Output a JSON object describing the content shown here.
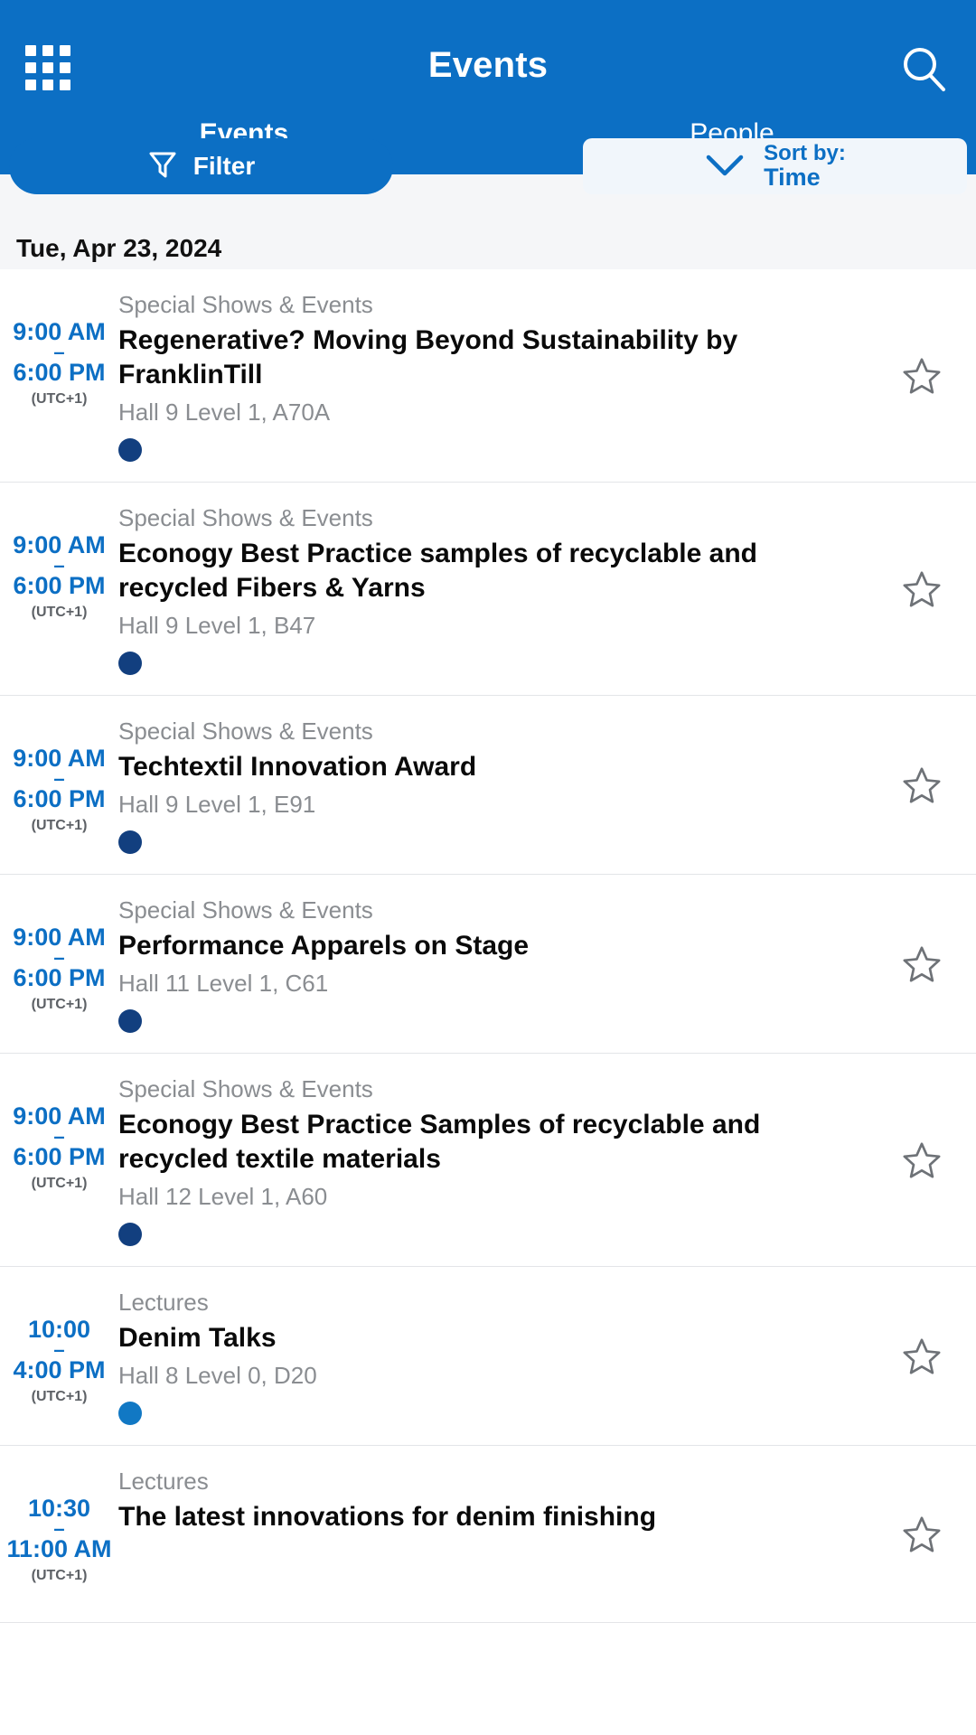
{
  "header": {
    "title": "Events",
    "menu_icon": "grid-icon",
    "search_icon": "search-icon"
  },
  "tabs": [
    {
      "label": "Events",
      "active": true
    },
    {
      "label": "People",
      "active": false
    }
  ],
  "toolbar": {
    "filter_label": "Filter",
    "filter_icon": "funnel-icon",
    "sort_line1": "Sort by:",
    "sort_line2": "Time",
    "sort_icon": "chevron-down-icon"
  },
  "date_header": "Tue, Apr 23, 2024",
  "colors": {
    "brand_blue": "#0C6FC4",
    "special_shows_dot": "#123F7F",
    "lectures_dot": "#1178C4",
    "tab_indicator": "#A8CCEB",
    "muted_text": "#8A8D91"
  },
  "events": [
    {
      "start": "9:00 AM",
      "dash": "–",
      "end": "6:00 PM",
      "tz": "(UTC+1)",
      "category": "Special Shows & Events",
      "title": "Regenerative? Moving Beyond Sustainability by FranklinTill",
      "location": "Hall 9 Level 1, A70A",
      "dot_color": "#123F7F",
      "starred": false
    },
    {
      "start": "9:00 AM",
      "dash": "–",
      "end": "6:00 PM",
      "tz": "(UTC+1)",
      "category": "Special Shows & Events",
      "title": "Econogy Best Practice samples of recyclable and recycled Fibers & Yarns",
      "location": "Hall 9 Level 1, B47",
      "dot_color": "#123F7F",
      "starred": false
    },
    {
      "start": "9:00 AM",
      "dash": "–",
      "end": "6:00 PM",
      "tz": "(UTC+1)",
      "category": "Special Shows & Events",
      "title": "Techtextil Innovation Award",
      "location": "Hall 9 Level 1, E91",
      "dot_color": "#123F7F",
      "starred": false
    },
    {
      "start": "9:00 AM",
      "dash": "–",
      "end": "6:00 PM",
      "tz": "(UTC+1)",
      "category": "Special Shows & Events",
      "title": "Performance Apparels on Stage",
      "location": "Hall 11 Level 1, C61",
      "dot_color": "#123F7F",
      "starred": false
    },
    {
      "start": "9:00 AM",
      "dash": "–",
      "end": "6:00 PM",
      "tz": "(UTC+1)",
      "category": "Special Shows & Events",
      "title": "Econogy Best Practice Samples of recyclable and recycled textile materials",
      "location": "Hall 12 Level 1, A60",
      "dot_color": "#123F7F",
      "starred": false
    },
    {
      "start": "10:00",
      "dash": "–",
      "end": "4:00 PM",
      "tz": "(UTC+1)",
      "category": "Lectures",
      "title": "Denim Talks",
      "location": "Hall 8 Level 0, D20",
      "dot_color": "#1178C4",
      "starred": false
    },
    {
      "start": "10:30",
      "dash": "–",
      "end": "11:00 AM",
      "tz": "(UTC+1)",
      "category": "Lectures",
      "title": "The latest innovations for denim finishing",
      "location": "",
      "dot_color": "#1178C4",
      "starred": false
    }
  ]
}
